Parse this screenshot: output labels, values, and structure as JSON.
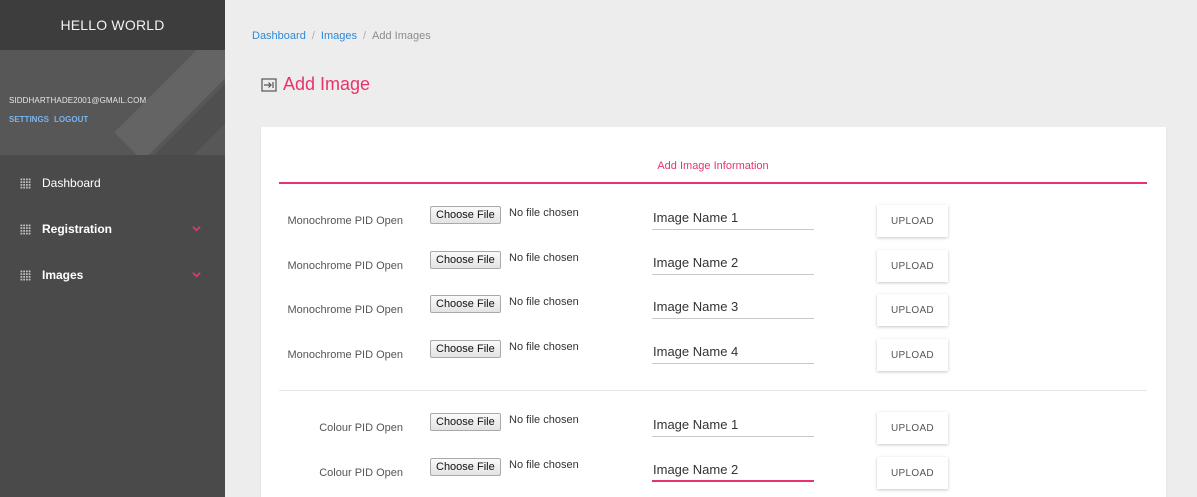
{
  "sidebar": {
    "brand": "HELLO WORLD",
    "user_email": "SIDDHARTHADE2001@GMAIL.COM",
    "settings_label": "SETTINGS",
    "logout_label": "LOGOUT",
    "items": [
      {
        "label": "Dashboard",
        "has_submenu": false
      },
      {
        "label": "Registration",
        "has_submenu": true
      },
      {
        "label": "Images",
        "has_submenu": true
      }
    ]
  },
  "breadcrumb": {
    "crumb1": "Dashboard",
    "separator": "/",
    "crumb2": "Images",
    "current": "Add Images"
  },
  "page": {
    "title": "Add Image",
    "title_icon": "input-icon",
    "section_title": "Add Image Information"
  },
  "rows": [
    {
      "label": "Monochrome PID Open",
      "file_button": "Choose File",
      "file_status": "No file chosen",
      "image_name": "Image Name 1",
      "upload_label": "UPLOAD"
    },
    {
      "label": "Monochrome PID Open",
      "file_button": "Choose File",
      "file_status": "No file chosen",
      "image_name": "Image Name 2",
      "upload_label": "UPLOAD"
    },
    {
      "label": "Monochrome PID Open",
      "file_button": "Choose File",
      "file_status": "No file chosen",
      "image_name": "Image Name 3",
      "upload_label": "UPLOAD"
    },
    {
      "label": "Monochrome PID Open",
      "file_button": "Choose File",
      "file_status": "No file chosen",
      "image_name": "Image Name 4",
      "upload_label": "UPLOAD"
    },
    {
      "label": "Colour PID Open",
      "file_button": "Choose File",
      "file_status": "No file chosen",
      "image_name": "Image Name 1",
      "upload_label": "UPLOAD"
    },
    {
      "label": "Colour PID Open",
      "file_button": "Choose File",
      "file_status": "No file chosen",
      "image_name": "Image Name 2",
      "upload_label": "UPLOAD"
    }
  ],
  "colors": {
    "accent": "#e8336b",
    "link": "#2e89d9",
    "sidebar_bg": "#4a4a4a"
  }
}
